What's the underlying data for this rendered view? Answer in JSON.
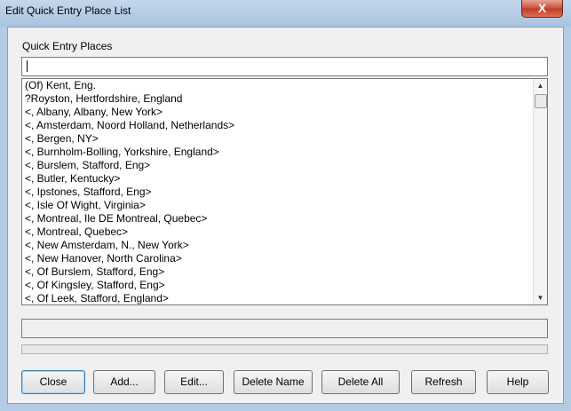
{
  "window": {
    "title": "Edit Quick Entry Place List",
    "close_glyph": "X"
  },
  "group": {
    "label": "Quick Entry Places"
  },
  "entry": {
    "value": "",
    "placeholder": ""
  },
  "places": [
    "(Of) Kent, Eng.",
    "?Royston, Hertfordshire, England",
    "<, Albany, Albany, New York>",
    "<, Amsterdam, Noord Holland, Netherlands>",
    "<, Bergen, NY>",
    "<, Burnholm-Bolling, Yorkshire, England>",
    "<, Burslem, Stafford, Eng>",
    "<, Butler, Kentucky>",
    "<, Ipstones, Stafford, Eng>",
    "<, Isle Of Wight, Virginia>",
    "<, Montreal, Ile DE Montreal, Quebec>",
    "<, Montreal, Quebec>",
    "<, New Amsterdam, N., New York>",
    "<, New Hanover, North Carolina>",
    "<, Of Burslem, Stafford, Eng>",
    "<, Of Kingsley, Stafford, Eng>",
    "<, Of Leek, Stafford, England>"
  ],
  "scrollbar": {
    "up_glyph": "▲",
    "down_glyph": "▼"
  },
  "status": {
    "text": ""
  },
  "progress": {
    "fraction": 0
  },
  "buttons": {
    "close": "Close",
    "add": "Add...",
    "edit": "Edit...",
    "delete_name": "Delete Name",
    "delete_all": "Delete All",
    "refresh": "Refresh",
    "help": "Help"
  }
}
